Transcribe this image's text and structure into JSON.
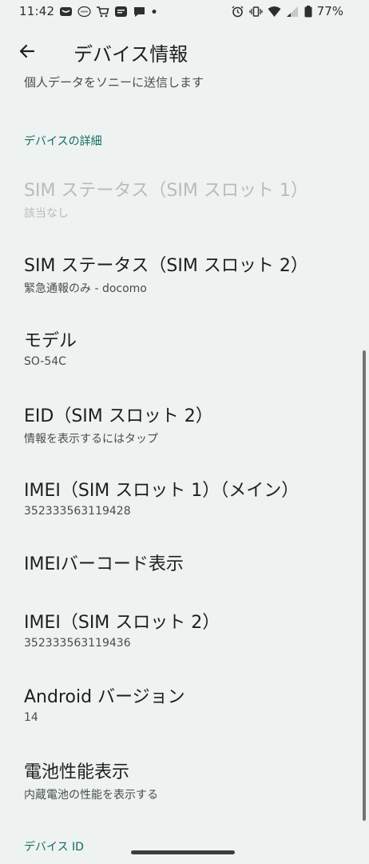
{
  "status_bar": {
    "time": "11:42",
    "battery_percent": "77%",
    "left_icons": [
      "mail-icon",
      "app-icon",
      "cart-icon",
      "line-icon",
      "chat-icon",
      "dot-icon"
    ],
    "right_icons": [
      "alarm-icon",
      "vibrate-icon",
      "wifi-icon",
      "signal-icon",
      "battery-icon"
    ]
  },
  "app_bar": {
    "title": "デバイス情報"
  },
  "top_partial": "個人データをソニーに送信します",
  "section_details": "デバイスの詳細",
  "items": [
    {
      "title": "SIM ステータス（SIM スロット 1）",
      "subtitle": "該当なし",
      "enabled": false
    },
    {
      "title": "SIM ステータス（SIM スロット 2）",
      "subtitle": "緊急通報のみ - docomo",
      "enabled": true
    },
    {
      "title": "モデル",
      "subtitle": "SO-54C",
      "enabled": true
    },
    {
      "title": "EID（SIM スロット 2）",
      "subtitle": "情報を表示するにはタップ",
      "enabled": true
    },
    {
      "title": "IMEI（SIM スロット 1）（メイン）",
      "subtitle": "352333563119428",
      "enabled": true
    },
    {
      "title": "IMEIバーコード表示",
      "subtitle": "",
      "enabled": true
    },
    {
      "title": "IMEI（SIM スロット 2）",
      "subtitle": "352333563119436",
      "enabled": true
    },
    {
      "title": "Android バージョン",
      "subtitle": "14",
      "enabled": true
    },
    {
      "title": "電池性能表示",
      "subtitle": "内蔵電池の性能を表示する",
      "enabled": true
    }
  ],
  "section_device_id": "デバイス ID",
  "colors": {
    "background": "#eef3f2",
    "accent": "#126b5f",
    "text": "#1b1f1e",
    "disabled_text": "#b6bcba"
  }
}
